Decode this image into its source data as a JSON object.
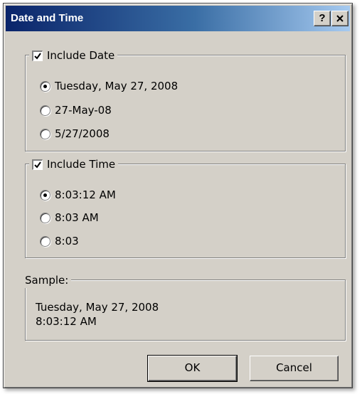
{
  "window": {
    "title": "Date and Time",
    "help_label": "?",
    "close_icon": "close-icon"
  },
  "date_group": {
    "checkbox_label": "Include Date",
    "checked": true,
    "options": [
      {
        "label": "Tuesday, May 27, 2008",
        "selected": true
      },
      {
        "label": "27-May-08",
        "selected": false
      },
      {
        "label": "5/27/2008",
        "selected": false
      }
    ]
  },
  "time_group": {
    "checkbox_label": "Include Time",
    "checked": true,
    "options": [
      {
        "label": "8:03:12 AM",
        "selected": true
      },
      {
        "label": "8:03 AM",
        "selected": false
      },
      {
        "label": "8:03",
        "selected": false
      }
    ]
  },
  "sample": {
    "label": "Sample:",
    "line1": "Tuesday, May 27, 2008",
    "line2": "8:03:12 AM"
  },
  "buttons": {
    "ok_label": "OK",
    "cancel_label": "Cancel"
  },
  "colors": {
    "title_gradient_start": "#0a246a",
    "title_gradient_end": "#a6caf0",
    "face": "#d4d0c8"
  }
}
